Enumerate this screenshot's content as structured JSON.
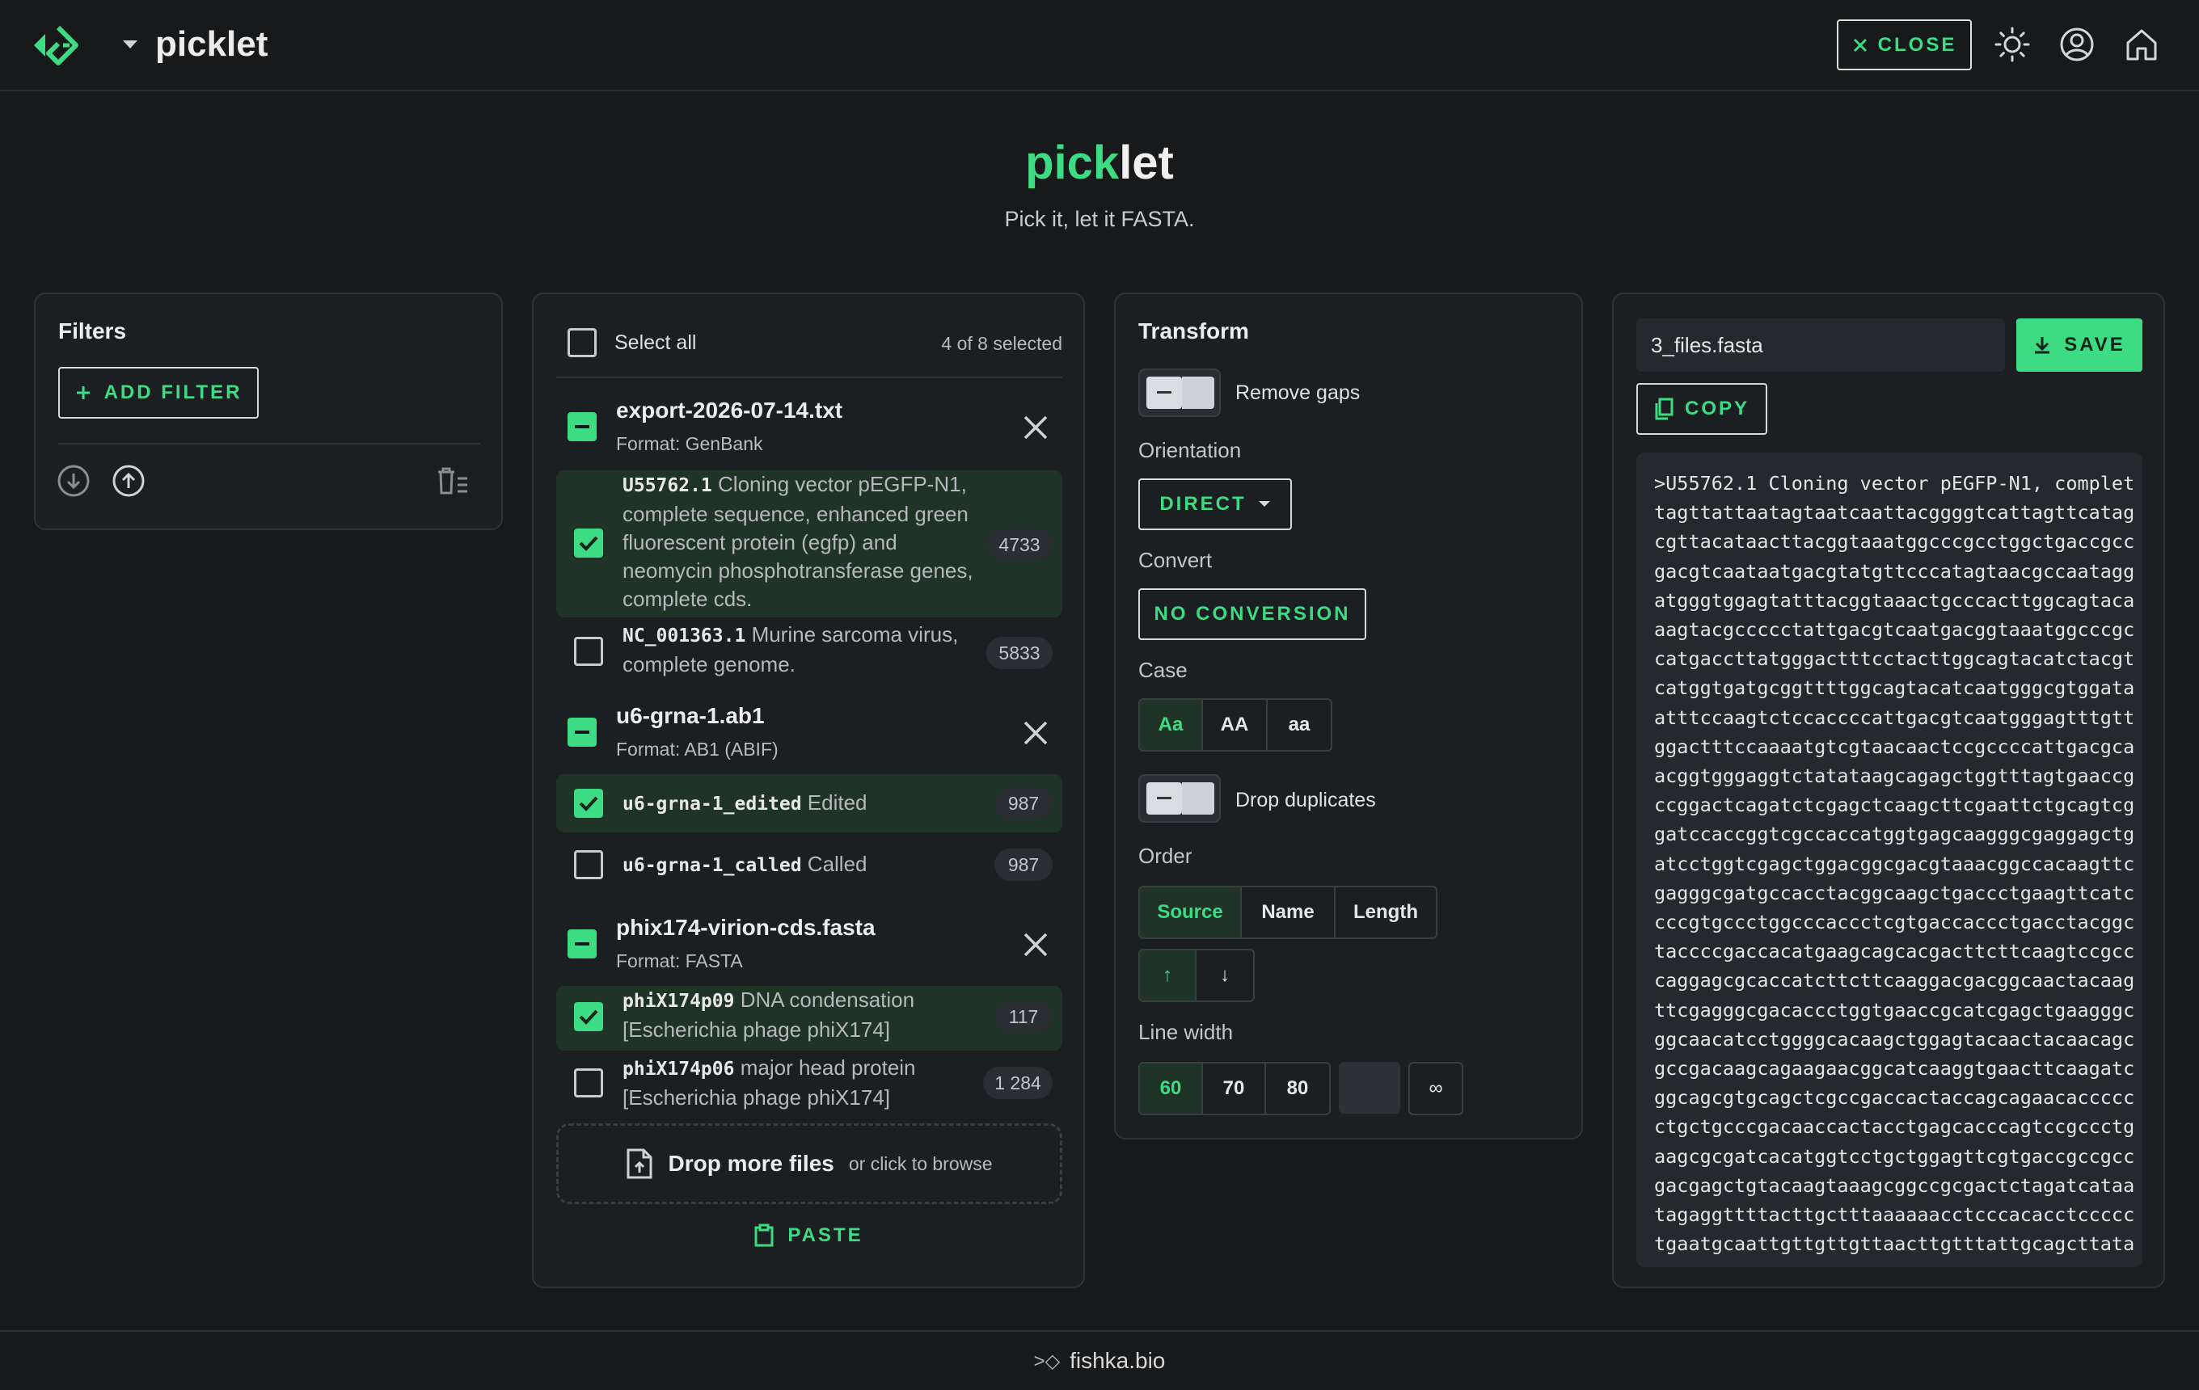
{
  "header": {
    "brand": "picklet",
    "close_label": "CLOSE",
    "icons": [
      "logo-icon",
      "theme-toggle-icon",
      "account-icon",
      "home-icon"
    ]
  },
  "hero": {
    "title_accent": "pick",
    "title_rest": "let",
    "subtitle": "Pick it, let it FASTA."
  },
  "filters": {
    "title": "Filters",
    "add_label": "ADD FILTER"
  },
  "files": {
    "select_all": "Select all",
    "selected_count": "4 of 8 selected",
    "groups": [
      {
        "name": "export-2026-07-14.txt",
        "format": "Format: GenBank",
        "records": [
          {
            "id": "U55762.1",
            "desc": "Cloning vector pEGFP-N1, complete sequence, enhanced green fluorescent protein (egfp) and neomycin phosphotransferase genes, complete cds.",
            "length": "4733",
            "selected": true
          },
          {
            "id": "NC_001363.1",
            "desc": "Murine sarcoma virus, complete genome.",
            "length": "5833",
            "selected": false
          }
        ]
      },
      {
        "name": "u6-grna-1.ab1",
        "format": "Format: AB1 (ABIF)",
        "records": [
          {
            "id": "u6-grna-1_edited",
            "desc": "Edited",
            "length": "987",
            "selected": true
          },
          {
            "id": "u6-grna-1_called",
            "desc": "Called",
            "length": "987",
            "selected": false
          }
        ]
      },
      {
        "name": "phix174-virion-cds.fasta",
        "format": "Format: FASTA",
        "records": [
          {
            "id": "phiX174p09",
            "desc": "DNA condensation [Escherichia phage phiX174]",
            "length": "117",
            "selected": true
          },
          {
            "id": "phiX174p06",
            "desc": "major head protein [Escherichia phage phiX174]",
            "length": "1 284",
            "selected": false
          }
        ]
      }
    ],
    "drop_label": "Drop more files",
    "drop_hint": "or click to browse",
    "paste_label": "PASTE"
  },
  "transform": {
    "title": "Transform",
    "remove_gaps": "Remove gaps",
    "orientation_label": "Orientation",
    "orientation_value": "DIRECT",
    "convert_label": "Convert",
    "convert_value": "NO CONVERSION",
    "case_label": "Case",
    "case_options": [
      "Aa",
      "AA",
      "aa"
    ],
    "drop_duplicates": "Drop duplicates",
    "order_label": "Order",
    "order_options": [
      "Source",
      "Name",
      "Length"
    ],
    "direction_options": [
      "↑",
      "↓"
    ],
    "line_width_label": "Line width",
    "line_width_options": [
      "60",
      "70",
      "80",
      "",
      "∞"
    ]
  },
  "output": {
    "filename": "3_files.fasta",
    "save_label": "SAVE",
    "copy_label": "COPY",
    "lines": [
      ">U55762.1 Cloning vector pEGFP-N1, complet",
      "tagttattaatagtaatcaattacggggtcattagttcatag",
      "cgttacataacttacggtaaatggcccgcctggctgaccgcc",
      "gacgtcaataatgacgtatgttcccatagtaacgccaatagg",
      "atgggtggagtatttacggtaaactgcccacttggcagtaca",
      "aagtacgccccctattgacgtcaatgacggtaaatggcccgc",
      "catgaccttatgggactttcctacttggcagtacatctacgt",
      "catggtgatgcggttttggcagtacatcaatgggcgtggata",
      "atttccaagtctccaccccattgacgtcaatgggagtttgtt",
      "ggactttccaaaatgtcgtaacaactccgccccattgacgca",
      "acggtgggaggtctatataagcagagctggtttagtgaaccg",
      "ccggactcagatctcgagctcaagcttcgaattctgcagtcg",
      "gatccaccggtcgccaccatggtgagcaagggcgaggagctg",
      "atcctggtcgagctggacggcgacgtaaacggccacaagttc",
      "gagggcgatgccacctacggcaagctgaccctgaagttcatc",
      "cccgtgccctggcccaccctcgtgaccaccctgacctacggc",
      "taccccgaccacatgaagcagcacgacttcttcaagtccgcc",
      "caggagcgcaccatcttcttcaaggacgacggcaactacaag",
      "ttcgagggcgacaccctggtgaaccgcatcgagctgaagggc",
      "ggcaacatcctggggcacaagctggagtacaactacaacagc",
      "gccgacaagcagaagaacggcatcaaggtgaacttcaagatc",
      "ggcagcgtgcagctcgccgaccactaccagcagaacaccccc",
      "ctgctgcccgacaaccactacctgagcacccagtccgccctg",
      "aagcgcgatcacatggtcctgctggagttcgtgaccgccgcc",
      "gacgagctgtacaagtaaagcggccgcgactctagatcataa",
      "tagaggttttacttgctttaaaaaacctcccacacctccccc",
      "tgaatgcaattgttgttgttaacttgtttattgcagcttata"
    ]
  },
  "footer": {
    "text": "fishka.bio",
    "prefix": ">◇"
  },
  "colors": {
    "accent": "#3ddc84",
    "background": "#17191b",
    "card": "#1c1f22"
  }
}
